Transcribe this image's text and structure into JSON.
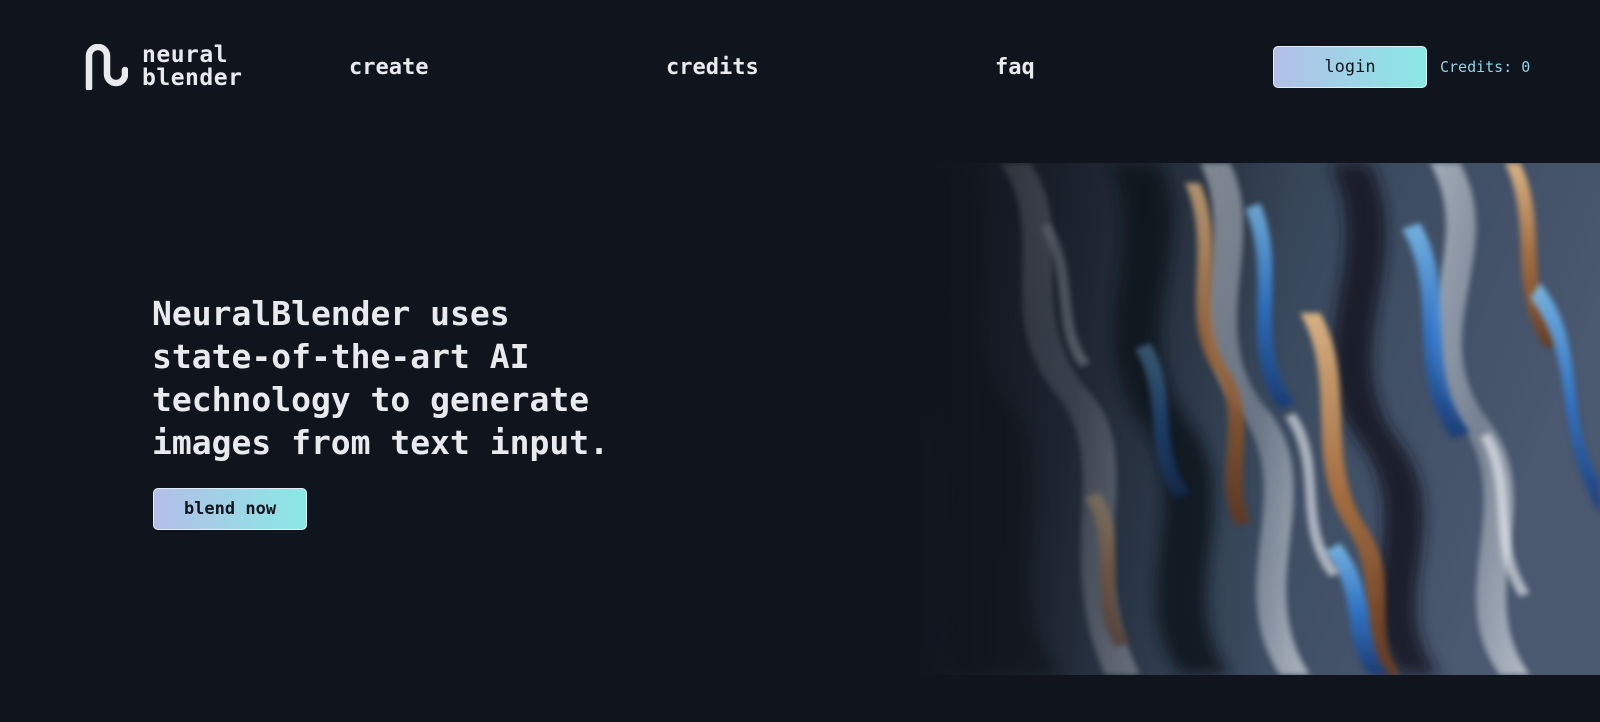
{
  "header": {
    "logo": {
      "line1": "neural",
      "line2": "blender",
      "icon": "squiggle-logo-icon"
    },
    "nav": [
      {
        "label": "create"
      },
      {
        "label": "credits"
      },
      {
        "label": "faq"
      }
    ],
    "login_label": "login",
    "credits_status": "Credits: 0"
  },
  "hero": {
    "headline_lines": [
      "NeuralBlender uses",
      "state-of-the-art AI",
      "technology to generate",
      "images from text input."
    ],
    "cta_label": "blend now"
  },
  "colors": {
    "background": "#10141d",
    "text": "#e8eaee",
    "accent_gradient_start": "#b3bfe8",
    "accent_gradient_end": "#8ae8e4",
    "credits_text": "#8fd3e8"
  }
}
